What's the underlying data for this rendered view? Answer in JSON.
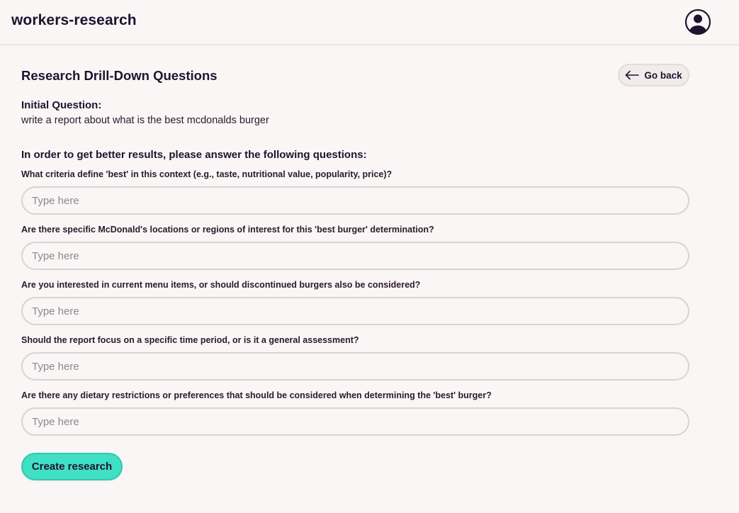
{
  "app": {
    "brand": "workers-research"
  },
  "header": {
    "avatar_icon": "user-circle-icon"
  },
  "page": {
    "title": "Research Drill-Down Questions",
    "back_button": {
      "label": "Go back",
      "icon": "arrow-left-icon"
    },
    "initial_question": {
      "label": "Initial Question:",
      "text": "write a report about what is the best mcdonalds burger"
    },
    "instructions": "In order to get better results, please answer the following questions:",
    "questions": [
      {
        "label": "What criteria define 'best' in this context (e.g., taste, nutritional value, popularity, price)?",
        "placeholder": "Type here",
        "value": ""
      },
      {
        "label": "Are there specific McDonald's locations or regions of interest for this 'best burger' determination?",
        "placeholder": "Type here",
        "value": ""
      },
      {
        "label": "Are you interested in current menu items, or should discontinued burgers also be considered?",
        "placeholder": "Type here",
        "value": ""
      },
      {
        "label": "Should the report focus on a specific time period, or is it a general assessment?",
        "placeholder": "Type here",
        "value": ""
      },
      {
        "label": "Are there any dietary restrictions or preferences that should be considered when determining the 'best' burger?",
        "placeholder": "Type here",
        "value": ""
      }
    ],
    "submit_label": "Create research"
  },
  "colors": {
    "background": "#faf6f5",
    "text": "#1f1330",
    "accent": "#3fe0c5",
    "input_border": "#d9d3d2"
  }
}
